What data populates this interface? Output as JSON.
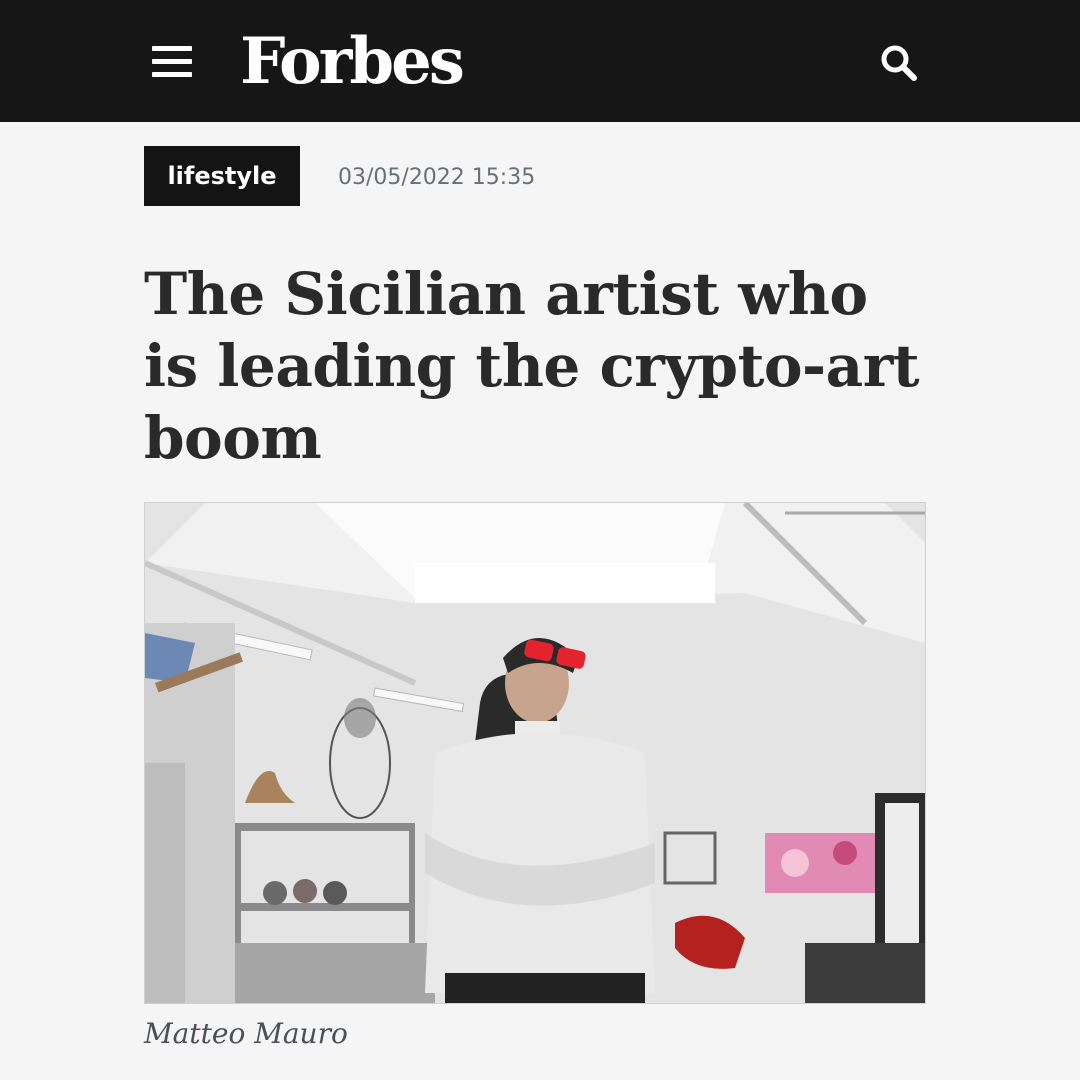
{
  "header": {
    "logo_text": "Forbes",
    "menu_icon": "hamburger-menu-icon",
    "search_icon": "search-icon",
    "background_color": "#161616"
  },
  "article": {
    "category": "lifestyle",
    "date": "03/05/2022 15:35",
    "headline": "The Sicilian artist who is leading the crypto-art boom",
    "image_caption": "Matteo Mauro"
  }
}
